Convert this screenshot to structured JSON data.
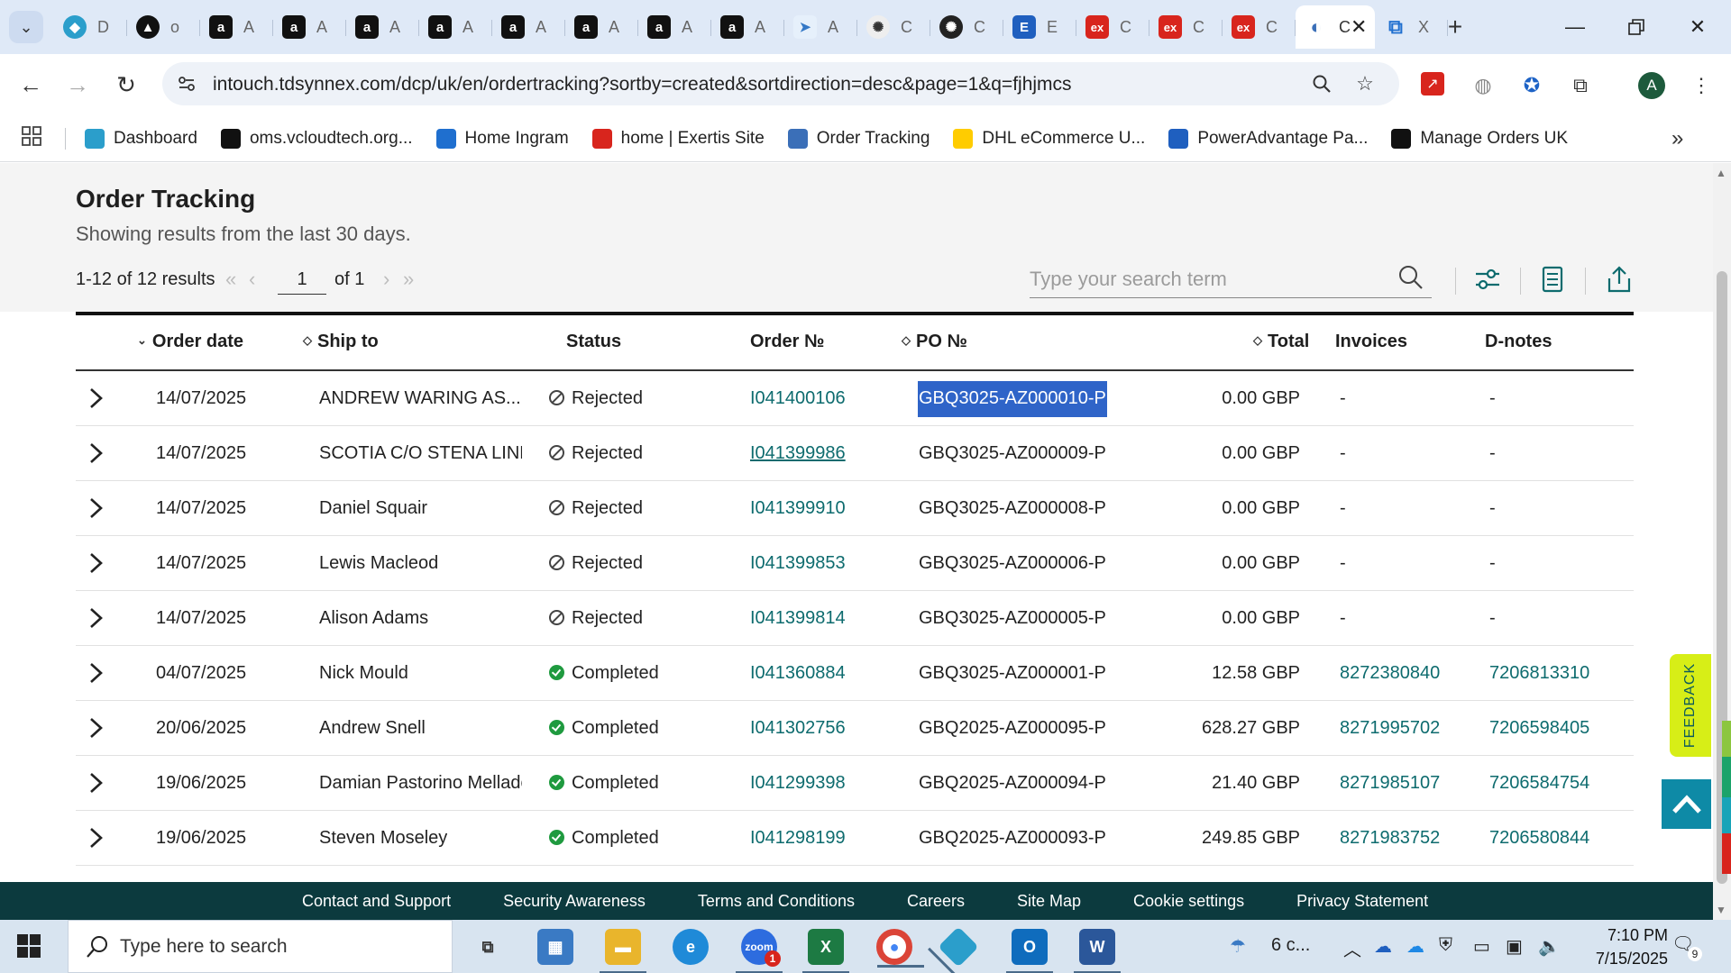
{
  "browser": {
    "tabs": [
      {
        "icon": "dashboard-icon",
        "label": "D",
        "type": "blue"
      },
      {
        "icon": "vcloud-icon",
        "label": "o",
        "type": "circle"
      },
      {
        "icon": "amazon-icon",
        "label": "A",
        "type": "amazon"
      },
      {
        "icon": "amazon-icon",
        "label": "A",
        "type": "amazon"
      },
      {
        "icon": "amazon-icon",
        "label": "A",
        "type": "amazon"
      },
      {
        "icon": "amazon-icon",
        "label": "A",
        "type": "amazon"
      },
      {
        "icon": "amazon-icon",
        "label": "A",
        "type": "amazon"
      },
      {
        "icon": "amazon-icon",
        "label": "A",
        "type": "amazon"
      },
      {
        "icon": "amazon-icon",
        "label": "A",
        "type": "amazon"
      },
      {
        "icon": "amazon-icon",
        "label": "A",
        "type": "amazon"
      },
      {
        "icon": "arrow-icon",
        "label": "A",
        "type": "teal"
      },
      {
        "icon": "chatgpt-icon",
        "label": "C",
        "type": "gpt"
      },
      {
        "icon": "chatgpt-icon",
        "label": "C",
        "type": "gptdark"
      },
      {
        "icon": "e-icon",
        "label": "E",
        "type": "e"
      },
      {
        "icon": "exertis-icon",
        "label": "C",
        "type": "ex"
      },
      {
        "icon": "exertis-icon",
        "label": "C",
        "type": "ex"
      },
      {
        "icon": "exertis-icon",
        "label": "C",
        "type": "ex"
      },
      {
        "icon": "tdsynnex-icon",
        "label": "C",
        "type": "tds",
        "active": true
      },
      {
        "icon": "ingram-icon",
        "label": "X",
        "type": "ig"
      }
    ],
    "url": "intouch.tdsynnex.com/dcp/uk/en/ordertracking?sortby=created&sortdirection=desc&page=1&q=fjhjmcs",
    "profile_initial": "A",
    "bookmarks": [
      {
        "label": "Dashboard",
        "icon": "dashboard-icon",
        "color": "#2b9ecb"
      },
      {
        "label": "oms.vcloudtech.org...",
        "icon": "vcloud-icon",
        "color": "#111111"
      },
      {
        "label": "Home Ingram",
        "icon": "ingram-icon",
        "color": "#1f6fcf"
      },
      {
        "label": "home | Exertis Site",
        "icon": "exertis-icon",
        "color": "#d8251d"
      },
      {
        "label": "Order Tracking",
        "icon": "tdsynnex-icon",
        "color": "#3b6fb8"
      },
      {
        "label": "DHL eCommerce U...",
        "icon": "dhl-icon",
        "color": "#ffcc00"
      },
      {
        "label": "PowerAdvantage Pa...",
        "icon": "poweradvantage-icon",
        "color": "#1f5fbf"
      },
      {
        "label": "Manage Orders UK",
        "icon": "amazon-icon",
        "color": "#111111"
      }
    ]
  },
  "page": {
    "title": "Order Tracking",
    "subtitle": "Showing results from the last 30 days.",
    "results_text": "1-12 of 12 results",
    "current_page": "1",
    "of_pages": "of 1",
    "search_placeholder": "Type your search term"
  },
  "table": {
    "columns": {
      "order_date": "Order date",
      "ship_to": "Ship to",
      "status": "Status",
      "order_no": "Order №",
      "po_no": "PO №",
      "total": "Total",
      "invoices": "Invoices",
      "dnotes": "D-notes"
    },
    "rows": [
      {
        "date": "14/07/2025",
        "ship_to": "ANDREW WARING AS...",
        "status": "Rejected",
        "order_no": "I041400106",
        "po_no": "GBQ3025-AZ000010-P",
        "total": "0.00 GBP",
        "invoice": "-",
        "dnote": "-",
        "selected_po": true
      },
      {
        "date": "14/07/2025",
        "ship_to": "SCOTIA C/O STENA LINE",
        "status": "Rejected",
        "order_no": "I041399986",
        "po_no": "GBQ3025-AZ000009-P",
        "total": "0.00 GBP",
        "invoice": "-",
        "dnote": "-",
        "hovered_order": true
      },
      {
        "date": "14/07/2025",
        "ship_to": "Daniel Squair",
        "status": "Rejected",
        "order_no": "I041399910",
        "po_no": "GBQ3025-AZ000008-P",
        "total": "0.00 GBP",
        "invoice": "-",
        "dnote": "-"
      },
      {
        "date": "14/07/2025",
        "ship_to": "Lewis Macleod",
        "status": "Rejected",
        "order_no": "I041399853",
        "po_no": "GBQ3025-AZ000006-P",
        "total": "0.00 GBP",
        "invoice": "-",
        "dnote": "-"
      },
      {
        "date": "14/07/2025",
        "ship_to": "Alison Adams",
        "status": "Rejected",
        "order_no": "I041399814",
        "po_no": "GBQ3025-AZ000005-P",
        "total": "0.00 GBP",
        "invoice": "-",
        "dnote": "-"
      },
      {
        "date": "04/07/2025",
        "ship_to": "Nick Mould",
        "status": "Completed",
        "order_no": "I041360884",
        "po_no": "GBQ3025-AZ000001-P",
        "total": "12.58 GBP",
        "invoice": "8272380840",
        "dnote": "7206813310"
      },
      {
        "date": "20/06/2025",
        "ship_to": "Andrew Snell",
        "status": "Completed",
        "order_no": "I041302756",
        "po_no": "GBQ2025-AZ000095-P",
        "total": "628.27 GBP",
        "invoice": "8271995702",
        "dnote": "7206598405"
      },
      {
        "date": "19/06/2025",
        "ship_to": "Damian Pastorino Mellado",
        "status": "Completed",
        "order_no": "I041299398",
        "po_no": "GBQ2025-AZ000094-P",
        "total": "21.40 GBP",
        "invoice": "8271985107",
        "dnote": "7206584754"
      },
      {
        "date": "19/06/2025",
        "ship_to": "Steven Moseley",
        "status": "Completed",
        "order_no": "I041298199",
        "po_no": "GBQ2025-AZ000093-P",
        "total": "249.85 GBP",
        "invoice": "8271983752",
        "dnote": "7206580844"
      }
    ]
  },
  "footer": {
    "links": [
      "Contact and Support",
      "Security Awareness",
      "Terms and Conditions",
      "Careers",
      "Site Map",
      "Cookie settings",
      "Privacy Statement"
    ]
  },
  "widgets": {
    "feedback_label": "FEEDBACK"
  },
  "taskbar": {
    "search_placeholder": "Type here to search",
    "weather": "6 c...",
    "time": "7:10 PM",
    "date": "7/15/2025",
    "notification_count": "9",
    "zoom_badge": "1"
  },
  "colors": {
    "accent_teal": "#0d6b6e",
    "footer_bg": "#0c3a3e",
    "feedback_bg": "#d7ee17",
    "completed_green": "#1f9a3f",
    "selection_blue": "#2f64c8"
  }
}
